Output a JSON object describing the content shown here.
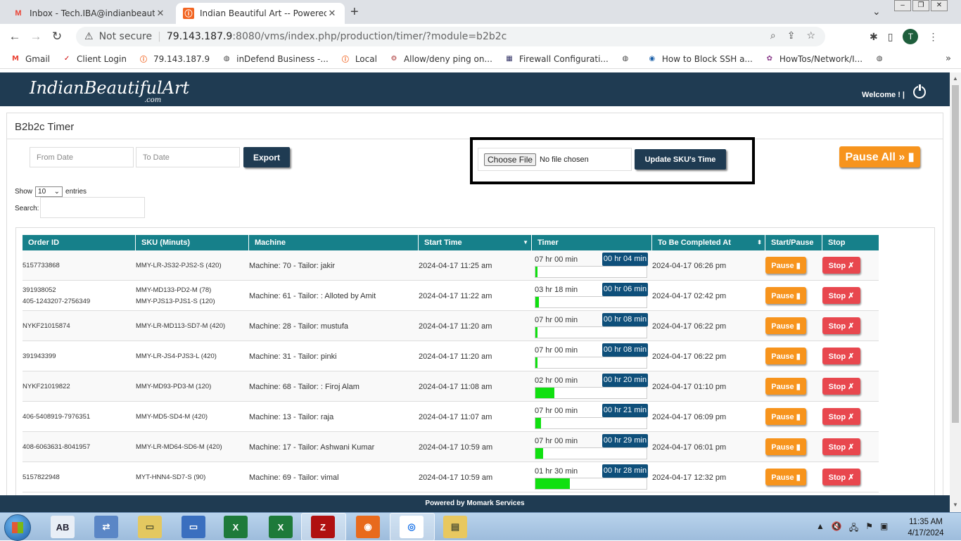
{
  "browser": {
    "tabs": [
      {
        "title": "Inbox - Tech.IBA@indianbeautiful",
        "icon": "gmail-icon"
      },
      {
        "title": "Indian Beautiful Art -- Powered b",
        "icon": "iba-icon"
      }
    ],
    "address": {
      "security": "Not secure",
      "host": "79.143.187.9",
      "rest": ":8080/vms/index.php/production/timer/?module=b2b2c"
    },
    "avatar_letter": "T",
    "bookmarks": [
      {
        "label": "Gmail",
        "icon": "M",
        "color": "#ea4335"
      },
      {
        "label": "Client Login",
        "icon": "✓",
        "color": "#c00"
      },
      {
        "label": "79.143.187.9",
        "icon": "ⓘ",
        "color": "#f26522"
      },
      {
        "label": "inDefend Business -...",
        "icon": "◍",
        "color": "#444"
      },
      {
        "label": "Local",
        "icon": "ⓘ",
        "color": "#f26522"
      },
      {
        "label": "Allow/deny ping on...",
        "icon": "⚙",
        "color": "#a33"
      },
      {
        "label": "Firewall Configurati...",
        "icon": "▦",
        "color": "#336"
      },
      {
        "label": "",
        "icon": "◍",
        "color": "#444"
      },
      {
        "label": "How to Block SSH a...",
        "icon": "◉",
        "color": "#1a5fa8"
      },
      {
        "label": "HowTos/Network/I...",
        "icon": "✿",
        "color": "#8a3a8a"
      },
      {
        "label": "",
        "icon": "◍",
        "color": "#444"
      }
    ]
  },
  "site": {
    "logo": "IndianBeautifulArt",
    "logo_suffix": ".com",
    "welcome": "Welcome !  |",
    "footer": "Powered by Momark Services"
  },
  "panel": {
    "title": "B2b2c Timer",
    "from_placeholder": "From Date",
    "to_placeholder": "To Date",
    "export_label": "Export",
    "choose_file_label": "Choose File",
    "no_file_label": "No file chosen",
    "update_label": "Update SKU's Time",
    "pause_all_label": "Pause All » ▮",
    "show_label": "Show",
    "entries_value": "10",
    "entries_label": "entries",
    "search_label": "Search:"
  },
  "table": {
    "headers": [
      "Order ID",
      "SKU (Minuts)",
      "Machine",
      "Start Time",
      "Timer",
      "To Be Completed At",
      "Start/Pause",
      "Stop"
    ],
    "pause_label": "Pause ▮",
    "stop_label": "Stop ✗",
    "rows": [
      {
        "order": [
          "5157733868"
        ],
        "sku": [
          "MMY-LR-JS32-PJS2-S (420)"
        ],
        "machine": "Machine: 70 - Tailor: jakir",
        "start": "2024-04-17 11:25 am",
        "duration": "07 hr 00 min",
        "elapsed": "00 hr 04 min",
        "progress": 0.01,
        "complete": "2024-04-17 06:26 pm"
      },
      {
        "order": [
          "391938052",
          "405-1243207-2756349"
        ],
        "sku": [
          "MMY-MD133-PD2-M (78)",
          "MMY-PJS13-PJS1-S (120)"
        ],
        "machine": "Machine: 61 - Tailor: : Alloted by Amit",
        "start": "2024-04-17 11:22 am",
        "duration": "03 hr 18 min",
        "elapsed": "00 hr 06 min",
        "progress": 0.03,
        "complete": "2024-04-17 02:42 pm"
      },
      {
        "order": [
          "NYKF21015874"
        ],
        "sku": [
          "MMY-LR-MD113-SD7-M (420)"
        ],
        "machine": "Machine: 28 - Tailor: mustufa",
        "start": "2024-04-17 11:20 am",
        "duration": "07 hr 00 min",
        "elapsed": "00 hr 08 min",
        "progress": 0.02,
        "complete": "2024-04-17 06:22 pm"
      },
      {
        "order": [
          "391943399"
        ],
        "sku": [
          "MMY-LR-JS4-PJS3-L (420)"
        ],
        "machine": "Machine: 31 - Tailor: pinki",
        "start": "2024-04-17 11:20 am",
        "duration": "07 hr 00 min",
        "elapsed": "00 hr 08 min",
        "progress": 0.02,
        "complete": "2024-04-17 06:22 pm"
      },
      {
        "order": [
          "NYKF21019822"
        ],
        "sku": [
          "MMY-MD93-PD3-M (120)"
        ],
        "machine": "Machine: 68 - Tailor: : Firoj Alam",
        "start": "2024-04-17 11:08 am",
        "duration": "02 hr 00 min",
        "elapsed": "00 hr 20 min",
        "progress": 0.17,
        "complete": "2024-04-17 01:10 pm"
      },
      {
        "order": [
          "406-5408919-7976351"
        ],
        "sku": [
          "MMY-MD5-SD4-M (420)"
        ],
        "machine": "Machine: 13 - Tailor: raja",
        "start": "2024-04-17 11:07 am",
        "duration": "07 hr 00 min",
        "elapsed": "00 hr 21 min",
        "progress": 0.05,
        "complete": "2024-04-17 06:09 pm"
      },
      {
        "order": [
          "408-6063631-8041957"
        ],
        "sku": [
          "MMY-LR-MD64-SD6-M (420)"
        ],
        "machine": "Machine: 17 - Tailor: Ashwani Kumar",
        "start": "2024-04-17 10:59 am",
        "duration": "07 hr 00 min",
        "elapsed": "00 hr 29 min",
        "progress": 0.07,
        "complete": "2024-04-17 06:01 pm"
      },
      {
        "order": [
          "5157822948"
        ],
        "sku": [
          "MYT-HNN4-SD7-S (90)"
        ],
        "machine": "Machine: 69 - Tailor: vimal",
        "start": "2024-04-17 10:59 am",
        "duration": "01 hr 30 min",
        "elapsed": "00 hr 28 min",
        "progress": 0.31,
        "complete": "2024-04-17 12:32 pm"
      }
    ]
  },
  "taskbar": {
    "time": "11:35 AM",
    "date": "4/17/2024",
    "apps": [
      "keyboard-app",
      "network-app",
      "folder-app",
      "drive-app",
      "excel-app",
      "excel-app-2",
      "filezilla-app",
      "firefox-app",
      "chrome-app",
      "explorer-app"
    ]
  }
}
